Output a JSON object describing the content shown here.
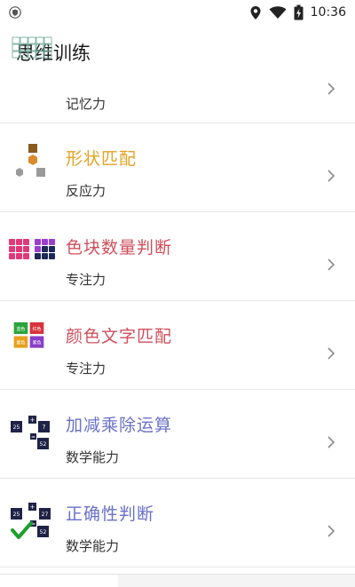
{
  "status_bar": {
    "time": "10:36",
    "icons": [
      "shield-icon",
      "location-icon",
      "wifi-icon",
      "battery-charging-icon"
    ]
  },
  "header": {
    "title": "思维训练"
  },
  "items": [
    {
      "title": "",
      "subtitle": "记忆力",
      "icon": "memory-grid-icon",
      "color": "#000000"
    },
    {
      "title": "形状匹配",
      "subtitle": "反应力",
      "icon": "shapes-icon",
      "color": "#E2A322"
    },
    {
      "title": "色块数量判断",
      "subtitle": "专注力",
      "icon": "color-blocks-icon",
      "color": "#CF4F5C"
    },
    {
      "title": "颜色文字匹配",
      "subtitle": "专注力",
      "icon": "color-words-icon",
      "color": "#CF4F5C",
      "icon_labels": [
        "蓝色",
        "红色",
        "紫色",
        "紫色"
      ]
    },
    {
      "title": "加减乘除运算",
      "subtitle": "数学能力",
      "icon": "arithmetic-icon",
      "color": "#6A6FC7",
      "icon_labels": [
        "25",
        "+",
        "?",
        "=",
        "52"
      ]
    },
    {
      "title": "正确性判断",
      "subtitle": "数学能力",
      "icon": "correctness-icon",
      "color": "#6A6FC7",
      "icon_labels": [
        "25",
        "+",
        "27",
        "=",
        "52"
      ]
    }
  ],
  "colors": {
    "memory_text": "#333333",
    "shape_brown": "#8B5A1E",
    "shape_orange": "#D98A2A",
    "shape_gray": "#9A9A9A",
    "block_pink": "#E2377A",
    "block_purple": "#9B3FD0",
    "block_navy": "#1E2A55",
    "word_green": "#2BA53B",
    "word_red": "#D8333A",
    "word_orange": "#E8A020",
    "word_purple": "#8A3DC8",
    "math_navy": "#1F2347",
    "check_green": "#1F9E2E"
  }
}
